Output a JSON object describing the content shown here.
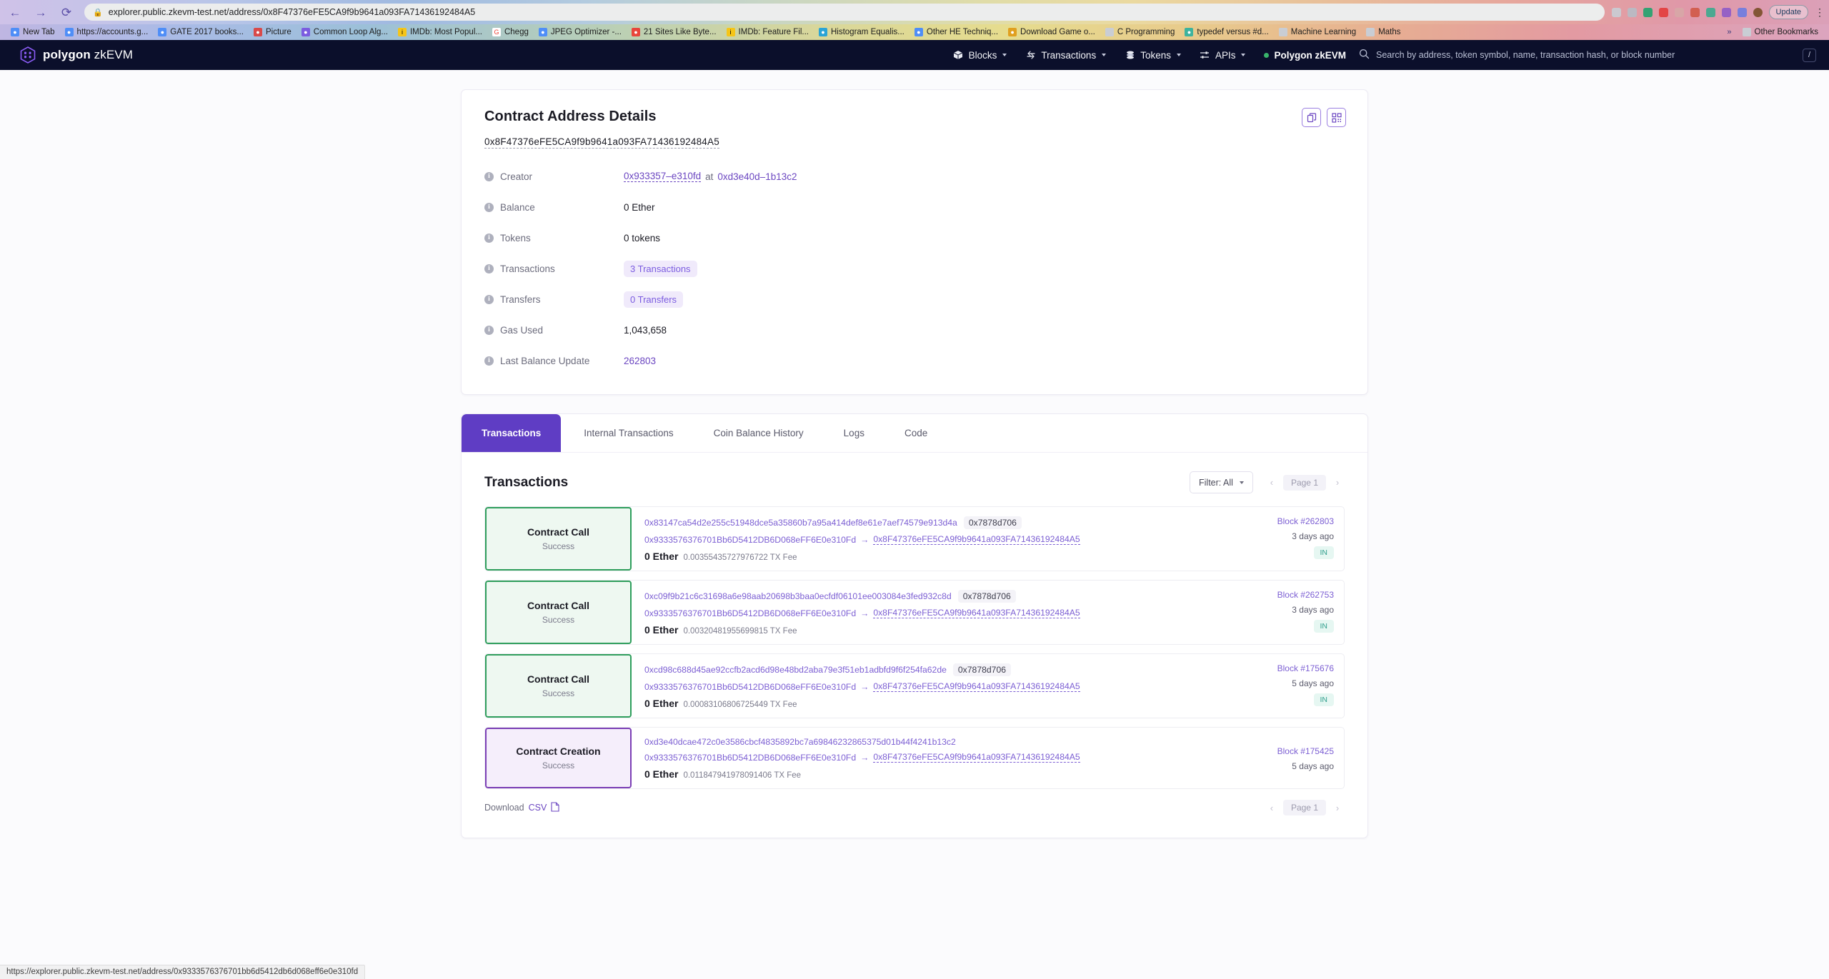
{
  "browser": {
    "back_icon": "←",
    "forward_icon": "→",
    "reload_icon": "⟳",
    "lock_icon": "🔒",
    "url": "explorer.public.zkevm-test.net/address/0x8F47376eFE5CA9f9b9641a093FA71436192484A5",
    "update_label": "Update",
    "menu_icon": "⋮",
    "bookmarks": [
      {
        "label": "New Tab",
        "color": "#4f8ef7"
      },
      {
        "label": "https://accounts.g...",
        "color": "#4f8ef7"
      },
      {
        "label": "GATE 2017 books...",
        "color": "#4f8ef7"
      },
      {
        "label": "Picture",
        "color": "#d94a4a"
      },
      {
        "label": "Common Loop Alg...",
        "color": "#7b5ce0"
      },
      {
        "label": "IMDb: Most Popul...",
        "color": "#f5c518"
      },
      {
        "label": "Chegg",
        "color": "#ea4335"
      },
      {
        "label": "JPEG Optimizer -...",
        "color": "#4f8ef7"
      },
      {
        "label": "21 Sites Like Byte...",
        "color": "#e8453c"
      },
      {
        "label": "IMDb: Feature Fil...",
        "color": "#f5c518"
      },
      {
        "label": "Histogram Equalis...",
        "color": "#2aa4d6"
      },
      {
        "label": "Other HE Techniq...",
        "color": "#4f8ef7"
      },
      {
        "label": "Download Game o...",
        "color": "#e0a020"
      },
      {
        "label": "C Programming",
        "color": "#c9cdd4"
      },
      {
        "label": "typedef versus #d...",
        "color": "#3db39e"
      },
      {
        "label": "Machine Learning",
        "color": "#c9cdd4"
      },
      {
        "label": "Maths",
        "color": "#c9cdd4"
      }
    ],
    "overflow_icon": "»",
    "other_bookmarks": "Other Bookmarks",
    "status_url": "https://explorer.public.zkevm-test.net/address/0x9333576376701bb6d5412db6d068eff6e0e310fd"
  },
  "header": {
    "brand_bold": "polygon",
    "brand_light": "zkEVM",
    "nav": [
      {
        "label": "Blocks",
        "icon": "cube-icon",
        "caret": true
      },
      {
        "label": "Transactions",
        "icon": "transactions-icon",
        "caret": true
      },
      {
        "label": "Tokens",
        "icon": "coins-icon",
        "caret": true
      },
      {
        "label": "APIs",
        "icon": "sliders-icon",
        "caret": true
      }
    ],
    "network": "Polygon zkEVM",
    "search_placeholder": "Search by address, token symbol, name, transaction hash, or block number",
    "search_value": "",
    "slash_key": "/"
  },
  "details": {
    "title": "Contract Address Details",
    "address": "0x8F47376eFE5CA9f9b9641a093FA71436192484A5",
    "copy_icon": "copy-icon",
    "qr_icon": "qr-code-icon",
    "rows": [
      {
        "label": "Creator",
        "value": "0x933357–e310fd",
        "suffix_at": "at",
        "suffix": "0xd3e40d–1b13c2",
        "kind": "creator"
      },
      {
        "label": "Balance",
        "value": "0 Ether",
        "kind": "plain"
      },
      {
        "label": "Tokens",
        "value": "0 tokens",
        "kind": "plain"
      },
      {
        "label": "Transactions",
        "value": "3 Transactions",
        "kind": "pill"
      },
      {
        "label": "Transfers",
        "value": "0 Transfers",
        "kind": "pill"
      },
      {
        "label": "Gas Used",
        "value": "1,043,658",
        "kind": "plain"
      },
      {
        "label": "Last Balance Update",
        "value": "262803",
        "kind": "link"
      }
    ]
  },
  "tabs": [
    {
      "label": "Transactions",
      "active": true
    },
    {
      "label": "Internal Transactions",
      "active": false
    },
    {
      "label": "Coin Balance History",
      "active": false
    },
    {
      "label": "Logs",
      "active": false
    },
    {
      "label": "Code",
      "active": false
    }
  ],
  "transactions_panel": {
    "title": "Transactions",
    "filter_label": "Filter: All",
    "page_label": "Page 1",
    "prev_icon": "‹",
    "next_icon": "›",
    "download_label": "Download",
    "download_csv": "CSV",
    "csv_icon": "file-icon",
    "bottom_page_label": "Page 1",
    "rows": [
      {
        "type": "Contract Call",
        "type_kind": "call",
        "status": "Success",
        "hash": "0x83147ca54d2e255c51948dce5a35860b7a95a414def8e61e7aef74579e913d4a",
        "method": "0x7878d706",
        "from": "0x9333576376701Bb6D5412DB6D068eFF6E0e310Fd",
        "arrow": "→",
        "to": "0x8F47376eFE5CA9f9b9641a093FA71436192484A5",
        "value": "0 Ether",
        "fee": "0.00355435727976722 TX Fee",
        "block": "Block #262803",
        "age": "3 days ago",
        "direction": "IN"
      },
      {
        "type": "Contract Call",
        "type_kind": "call",
        "status": "Success",
        "hash": "0xc09f9b21c6c31698a6e98aab20698b3baa0ecfdf06101ee003084e3fed932c8d",
        "method": "0x7878d706",
        "from": "0x9333576376701Bb6D5412DB6D068eFF6E0e310Fd",
        "arrow": "→",
        "to": "0x8F47376eFE5CA9f9b9641a093FA71436192484A5",
        "value": "0 Ether",
        "fee": "0.00320481955699815 TX Fee",
        "block": "Block #262753",
        "age": "3 days ago",
        "direction": "IN"
      },
      {
        "type": "Contract Call",
        "type_kind": "call",
        "status": "Success",
        "hash": "0xcd98c688d45ae92ccfb2acd6d98e48bd2aba79e3f51eb1adbfd9f6f254fa62de",
        "method": "0x7878d706",
        "from": "0x9333576376701Bb6D5412DB6D068eFF6E0e310Fd",
        "arrow": "→",
        "to": "0x8F47376eFE5CA9f9b9641a093FA71436192484A5",
        "value": "0 Ether",
        "fee": "0.00083106806725449 TX Fee",
        "block": "Block #175676",
        "age": "5 days ago",
        "direction": "IN"
      },
      {
        "type": "Contract Creation",
        "type_kind": "creation",
        "status": "Success",
        "hash": "0xd3e40dcae472c0e3586cbcf4835892bc7a69846232865375d01b44f4241b13c2",
        "method": "",
        "from": "0x9333576376701Bb6D5412DB6D068eFF6E0e310Fd",
        "arrow": "→",
        "to": "0x8F47376eFE5CA9f9b9641a093FA71436192484A5",
        "value": "0 Ether",
        "fee": "0.011847941978091406 TX Fee",
        "block": "Block #175425",
        "age": "5 days ago",
        "direction": ""
      }
    ]
  },
  "colors": {
    "brand_purple": "#6b46c1",
    "header_bg": "#0b0f2b",
    "tab_active": "#5f3dc4",
    "success_green": "#2f9e5c",
    "creation_purple": "#7b3fb5"
  }
}
